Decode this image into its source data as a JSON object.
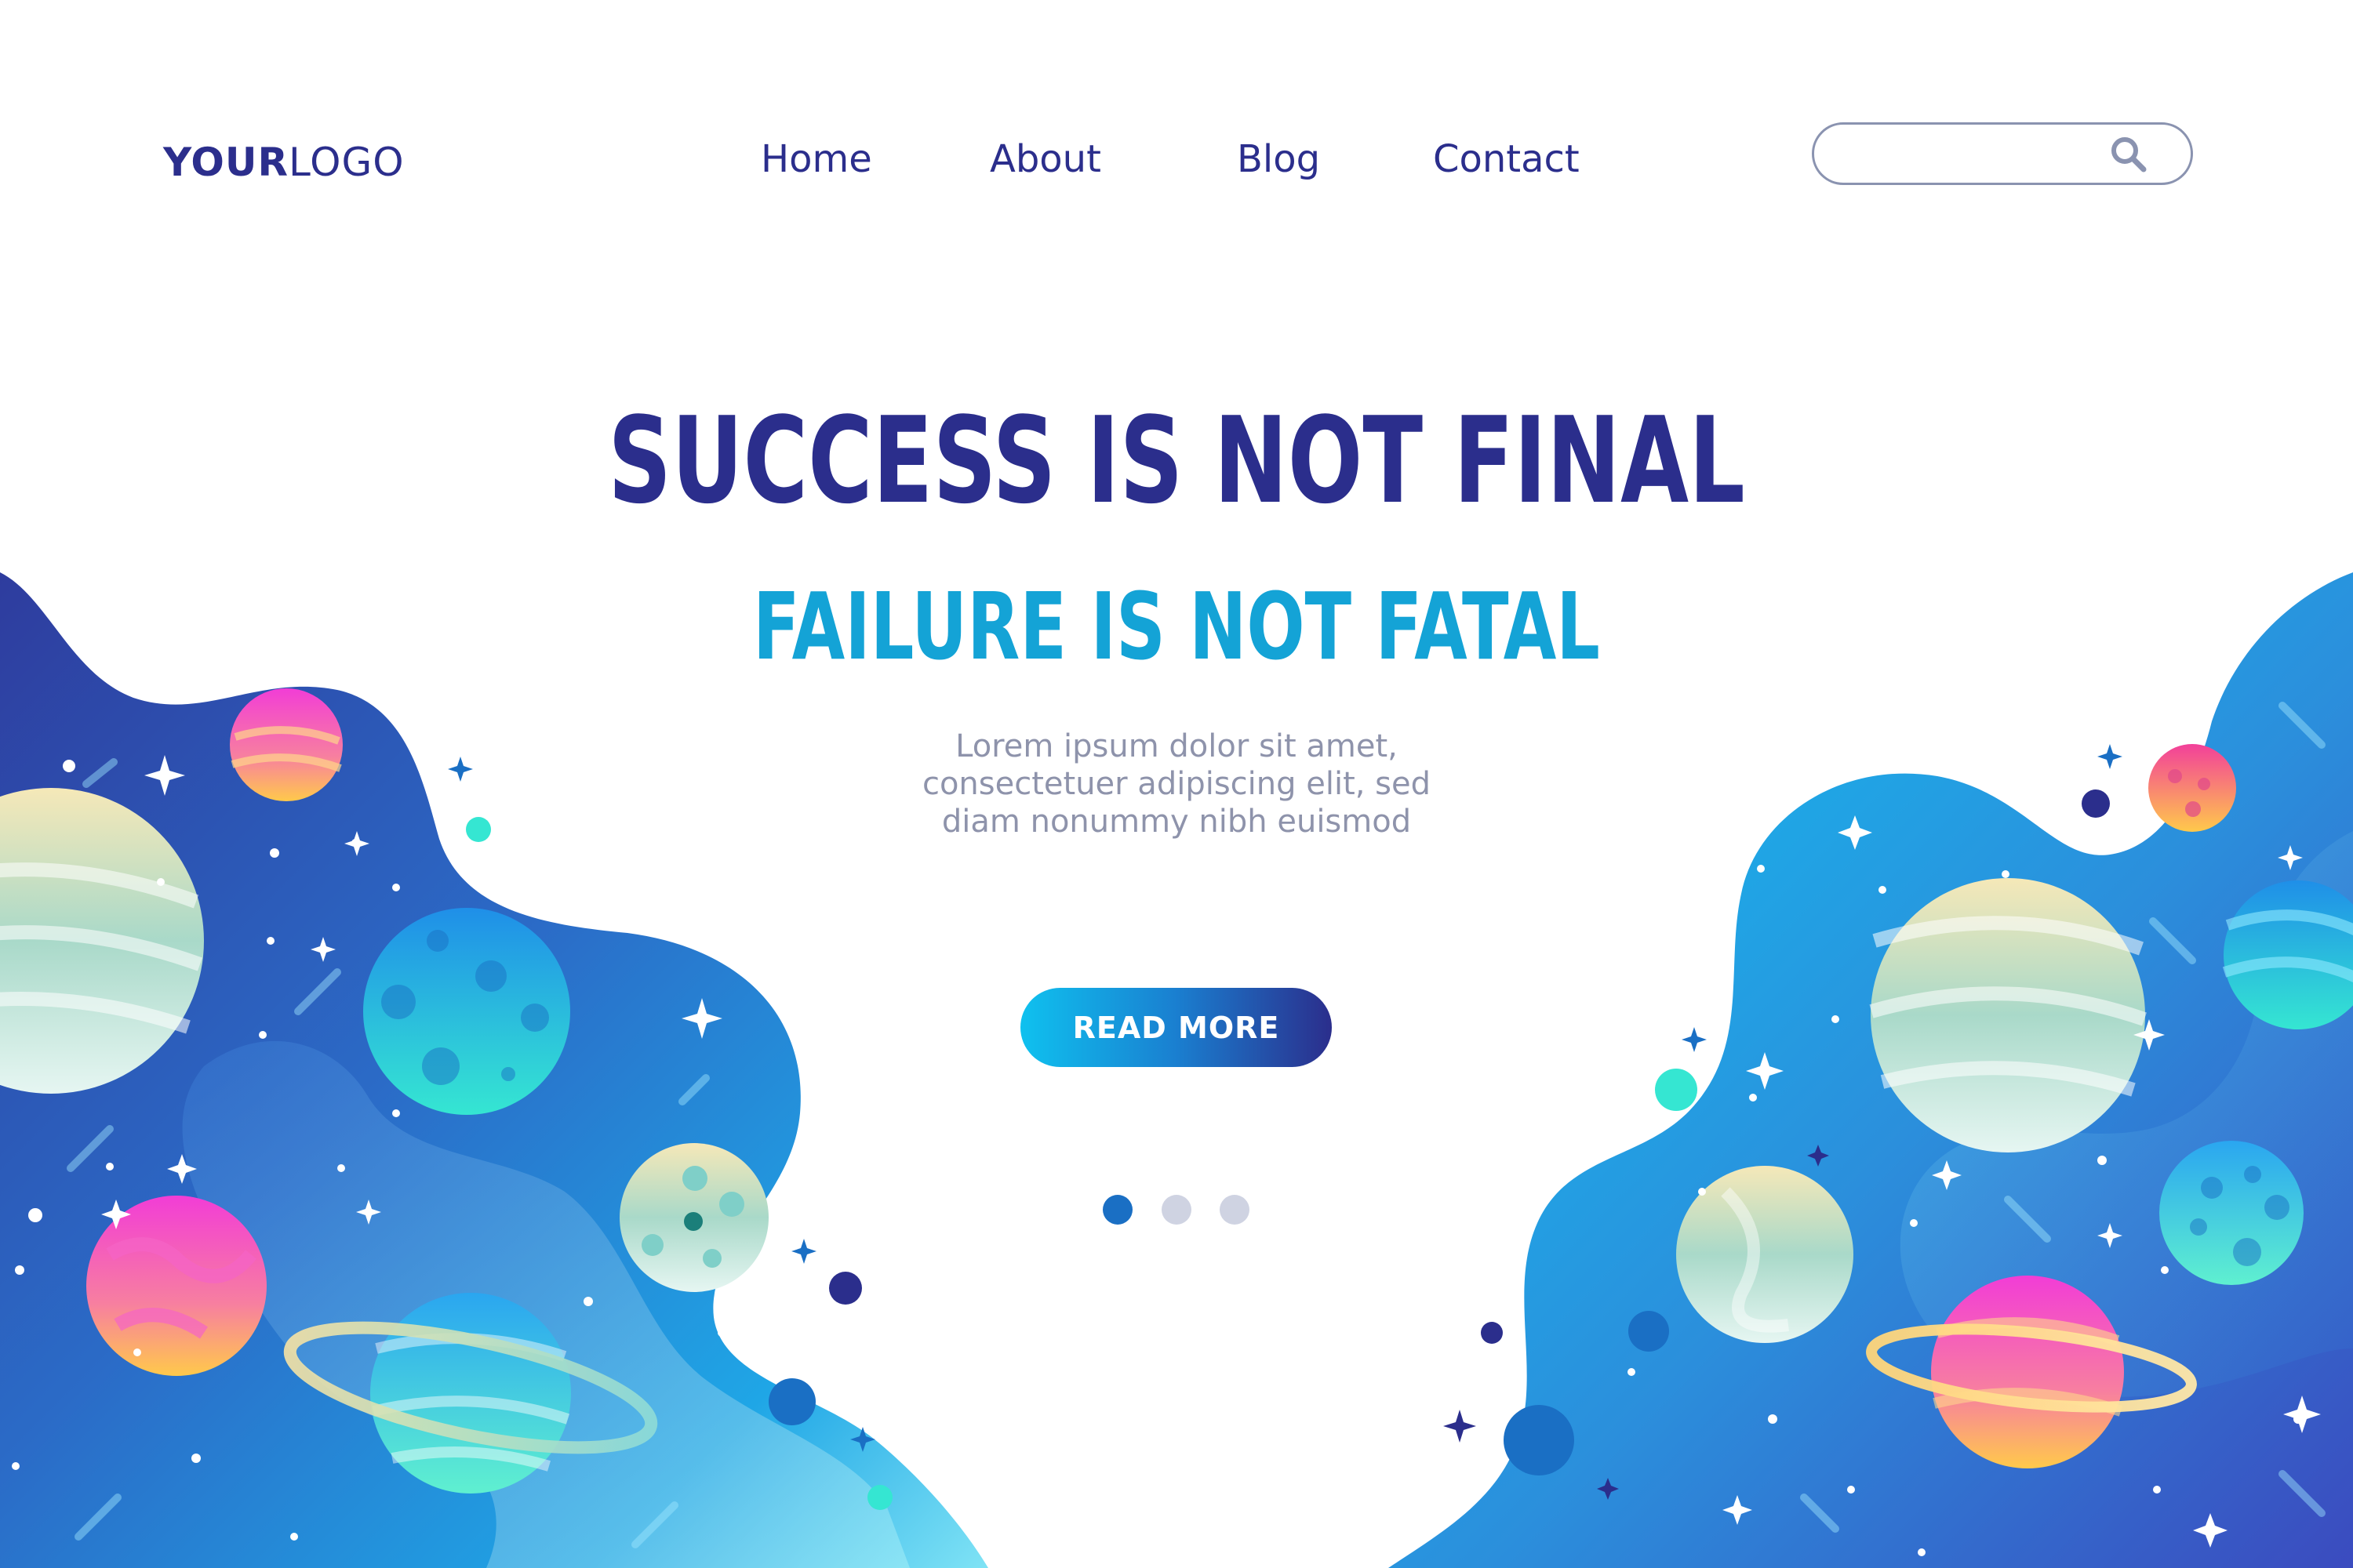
{
  "header": {
    "logo_bold": "YOUR",
    "logo_light": "LOGO",
    "nav": [
      {
        "label": "Home"
      },
      {
        "label": "About"
      },
      {
        "label": "Blog"
      },
      {
        "label": "Contact"
      }
    ],
    "search": {
      "placeholder": "",
      "value": ""
    }
  },
  "hero": {
    "headline": "SUCCESS IS NOT FINAL",
    "subheadline": "FAILURE IS NOT FATAL",
    "body_lines": [
      "Lorem ipsum dolor sit amet,",
      "consectetuer adipiscing elit, sed",
      "diam nonummy nibh euismod"
    ],
    "button_label": "READ MORE"
  },
  "carousel": {
    "slide_count": 3,
    "active_index": 0
  },
  "colors": {
    "primary": "#2b2e8c",
    "accent": "#14a3d6",
    "dot_active": "#1a6fc4",
    "dot_inactive": "#cfd3e2",
    "body_text": "#8e93ab"
  },
  "icons": {
    "search": "search-icon"
  }
}
